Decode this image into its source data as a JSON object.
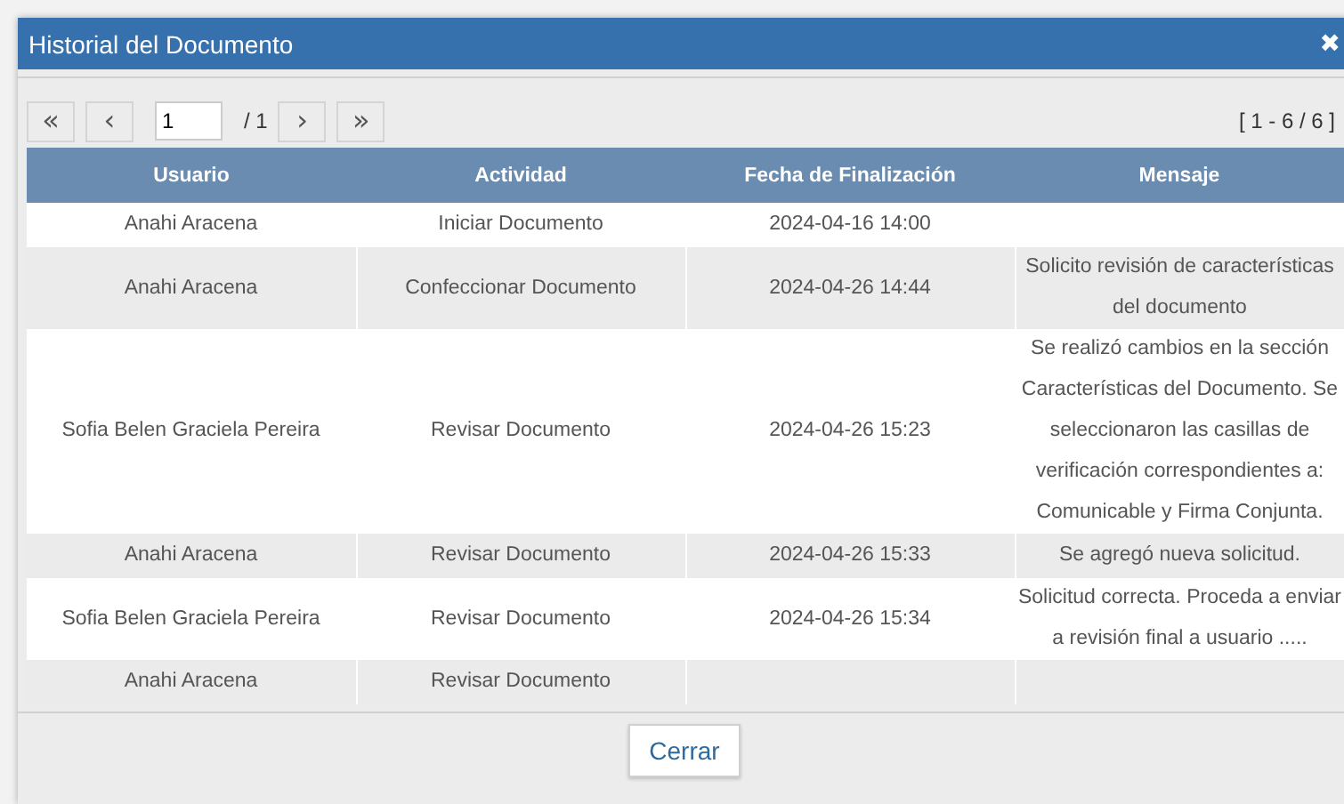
{
  "window": {
    "title": "Historial del Documento",
    "close": "✖"
  },
  "pager": {
    "first": "«",
    "previous": "‹",
    "page": "1",
    "total": "/ 1",
    "next": "›",
    "last": "»",
    "range": "[ 1 - 6 / 6 ]"
  },
  "table": {
    "columns": [
      "Usuario",
      "Actividad",
      "Fecha de Finalización",
      "Mensaje"
    ],
    "rows": [
      [
        "Anahi Aracena",
        "Iniciar Documento",
        "2024-04-16 14:00",
        ""
      ],
      [
        "Anahi Aracena",
        "Confeccionar Documento",
        "2024-04-26 14:44",
        "Solicito revisión de características del documento"
      ],
      [
        "Sofia Belen Graciela Pereira",
        "Revisar Documento",
        "2024-04-26 15:23",
        "Se realizó cambios en la sección Características del Documento. Se seleccionaron las casillas de verificación correspondientes a: Comunicable y Firma Conjunta."
      ],
      [
        "Anahi Aracena",
        "Revisar Documento",
        "2024-04-26 15:33",
        "Se agregó nueva solicitud."
      ],
      [
        "Sofia Belen Graciela Pereira",
        "Revisar Documento",
        "2024-04-26 15:34",
        "Solicitud correcta. Proceda a enviar a revisión final a usuario ....."
      ],
      [
        "Anahi Aracena",
        "Revisar Documento",
        "",
        ""
      ]
    ]
  },
  "buttons": [
    "Cerrar"
  ]
}
